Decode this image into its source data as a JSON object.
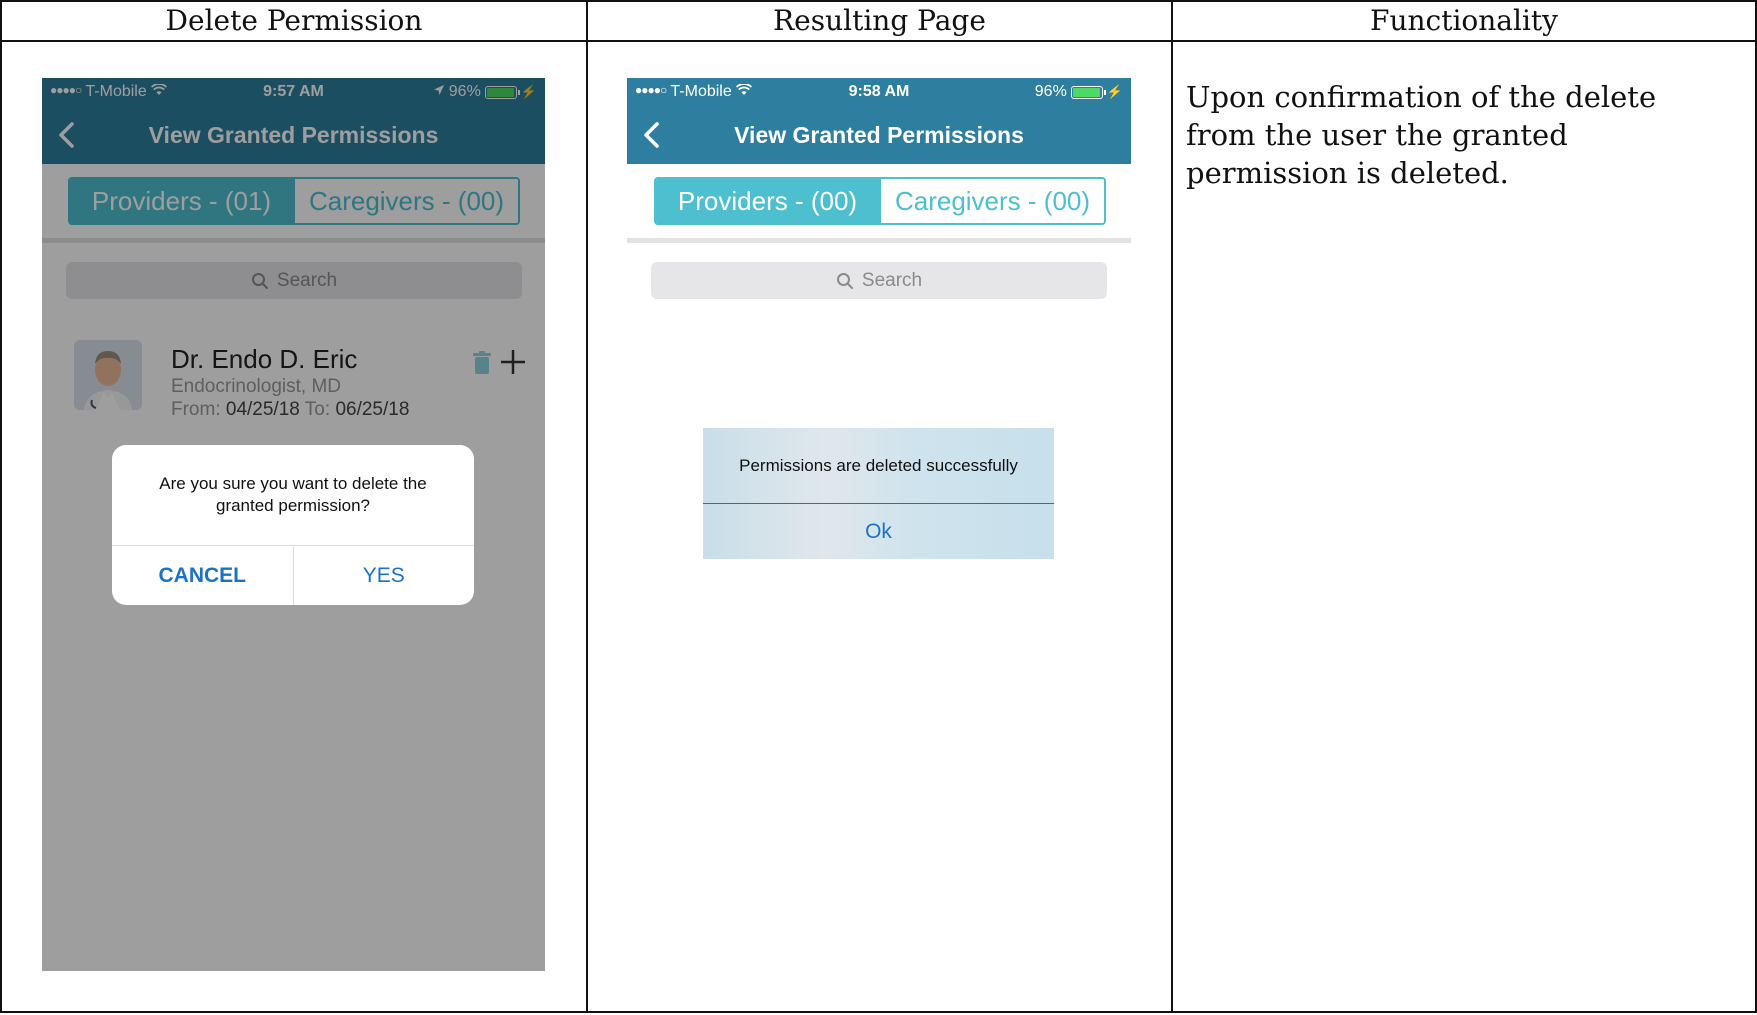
{
  "table": {
    "headers": [
      "Delete Permission",
      "Resulting Page",
      "Functionality"
    ],
    "functionality_text": "Upon confirmation of the delete from the user the granted permission is deleted."
  },
  "screen_delete": {
    "status": {
      "carrier": "T-Mobile",
      "time": "9:57 AM",
      "battery": "96%"
    },
    "nav_title": "View Granted Permissions",
    "tabs": {
      "providers": "Providers - (01)",
      "caregivers": "Caregivers - (00)",
      "active": "providers"
    },
    "search_placeholder": "Search",
    "provider": {
      "name": "Dr. Endo D. Eric",
      "specialty": "Endocrinologist, MD",
      "from_label": "From:",
      "from_date": "04/25/18",
      "to_label": "To:",
      "to_date": "06/25/18"
    },
    "dialog": {
      "message": "Are you sure you want to delete the granted permission?",
      "cancel_label": "CANCEL",
      "yes_label": "YES"
    }
  },
  "screen_result": {
    "status": {
      "carrier": "T-Mobile",
      "time": "9:58 AM",
      "battery": "96%"
    },
    "nav_title": "View Granted Permissions",
    "tabs": {
      "providers": "Providers - (00)",
      "caregivers": "Caregivers - (00)",
      "active": "providers"
    },
    "search_placeholder": "Search",
    "toast": {
      "message": "Permissions are deleted successfully",
      "ok_label": "Ok"
    }
  },
  "colors": {
    "header_bar": "#2e7f9f",
    "segment_accent": "#4dbfcf",
    "link_blue": "#1a73c9",
    "battery_green": "#4cd964"
  },
  "icons": [
    "back-chevron-icon",
    "wifi-icon",
    "location-arrow-icon",
    "battery-icon",
    "charging-bolt-icon",
    "search-icon",
    "trash-icon",
    "plus-icon"
  ]
}
